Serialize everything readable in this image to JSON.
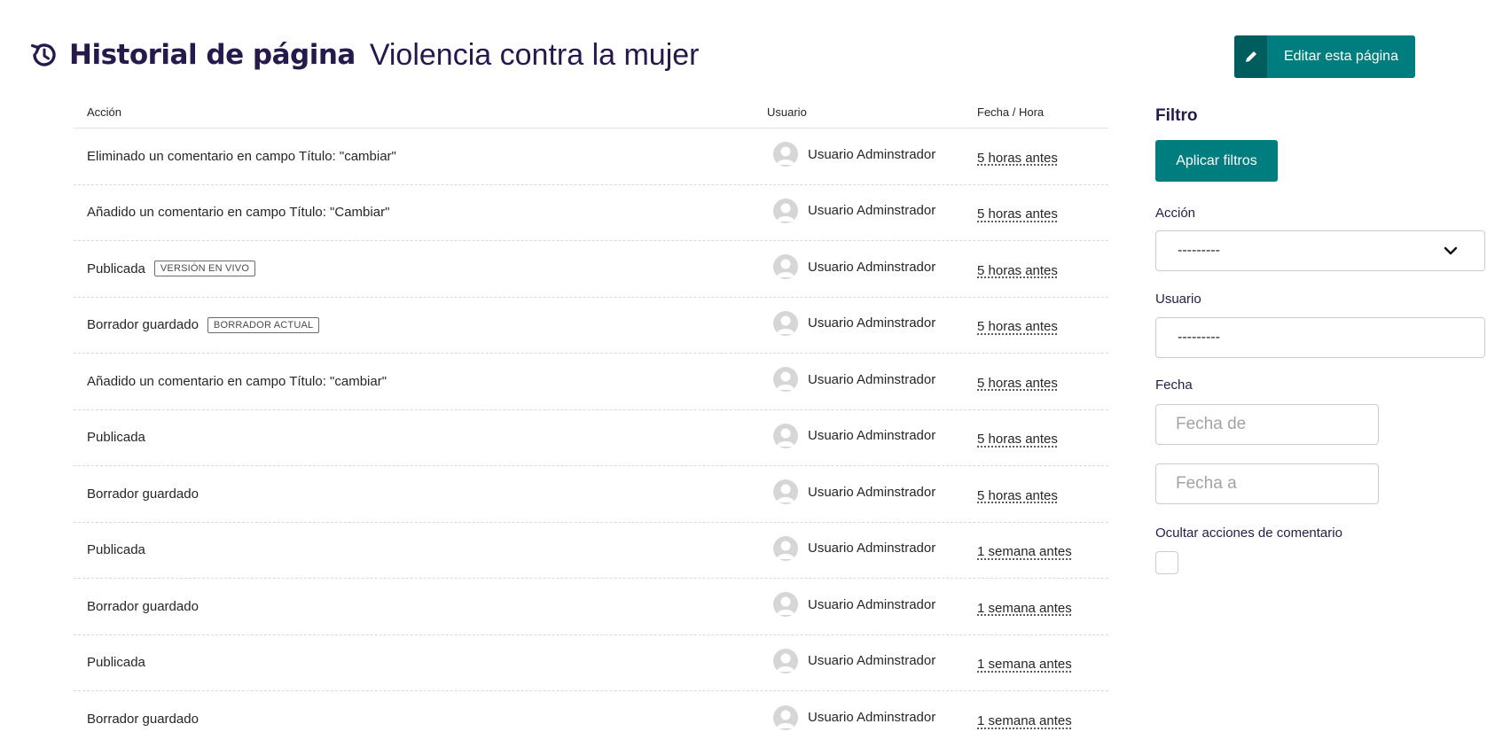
{
  "header": {
    "title": "Historial de página",
    "subtitle": "Violencia contra la mujer",
    "icon": "history-icon"
  },
  "edit_button": {
    "label": "Editar esta página",
    "icon": "pencil-icon"
  },
  "table": {
    "headers": {
      "action": "Acción",
      "user": "Usuario",
      "date": "Fecha / Hora"
    },
    "rows": [
      {
        "action": "Eliminado un comentario en campo Título: \"cambiar\"",
        "tag": "",
        "user": "Usuario Adminstrador",
        "date": "5 horas antes"
      },
      {
        "action": "Añadido un comentario en campo Título: \"Cambiar\"",
        "tag": "",
        "user": "Usuario Adminstrador",
        "date": "5 horas antes"
      },
      {
        "action": "Publicada",
        "tag": "Versión en vivo",
        "user": "Usuario Adminstrador",
        "date": "5 horas antes"
      },
      {
        "action": "Borrador guardado",
        "tag": "Borrador actual",
        "user": "Usuario Adminstrador",
        "date": "5 horas antes"
      },
      {
        "action": "Añadido un comentario en campo Título: \"cambiar\"",
        "tag": "",
        "user": "Usuario Adminstrador",
        "date": "5 horas antes"
      },
      {
        "action": "Publicada",
        "tag": "",
        "user": "Usuario Adminstrador",
        "date": "5 horas antes"
      },
      {
        "action": "Borrador guardado",
        "tag": "",
        "user": "Usuario Adminstrador",
        "date": "5 horas antes"
      },
      {
        "action": "Publicada",
        "tag": "",
        "user": "Usuario Adminstrador",
        "date": "1 semana antes"
      },
      {
        "action": "Borrador guardado",
        "tag": "",
        "user": "Usuario Adminstrador",
        "date": "1 semana antes"
      },
      {
        "action": "Publicada",
        "tag": "",
        "user": "Usuario Adminstrador",
        "date": "1 semana antes"
      },
      {
        "action": "Borrador guardado",
        "tag": "",
        "user": "Usuario Adminstrador",
        "date": "1 semana antes"
      }
    ]
  },
  "filters": {
    "title": "Filtro",
    "apply_label": "Aplicar filtros",
    "action_label": "Acción",
    "action_value": "---------",
    "user_label": "Usuario",
    "user_value": "---------",
    "date_label": "Fecha",
    "date_from_placeholder": "Fecha de",
    "date_to_placeholder": "Fecha a",
    "hide_comments_label": "Ocultar acciones de comentario",
    "hide_comments_checked": false
  },
  "colors": {
    "brand": "#007d7e",
    "brand_dark": "#005d5e",
    "title": "#261a4d"
  }
}
